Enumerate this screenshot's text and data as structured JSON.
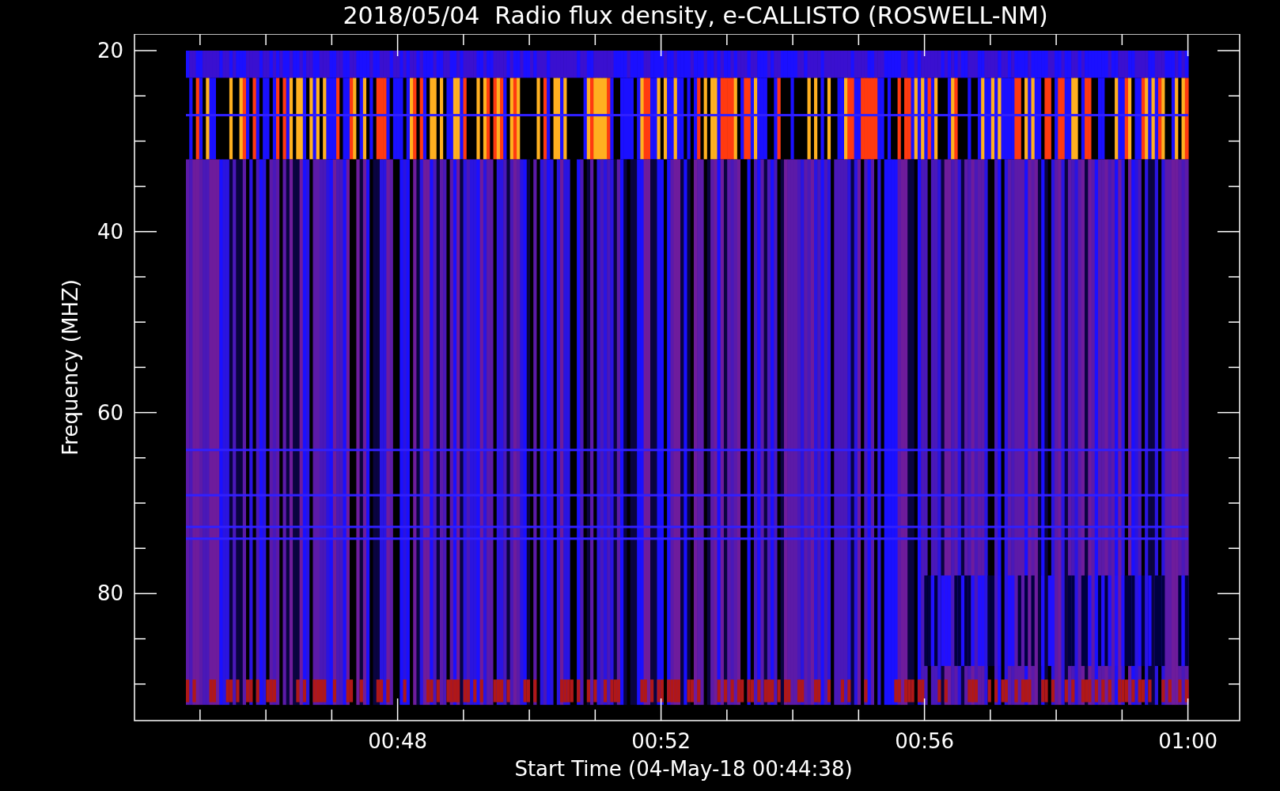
{
  "title": "2018/05/04  Radio flux density, e-CALLISTO (ROSWELL-NM)",
  "y_axis": {
    "label": "Frequency (MHZ)",
    "ticks": [
      "20",
      "40",
      "60",
      "80"
    ]
  },
  "x_axis": {
    "label": "Start Time (04-May-18 00:44:38)",
    "ticks": [
      "00:48",
      "00:52",
      "00:56",
      "01:00"
    ]
  }
}
